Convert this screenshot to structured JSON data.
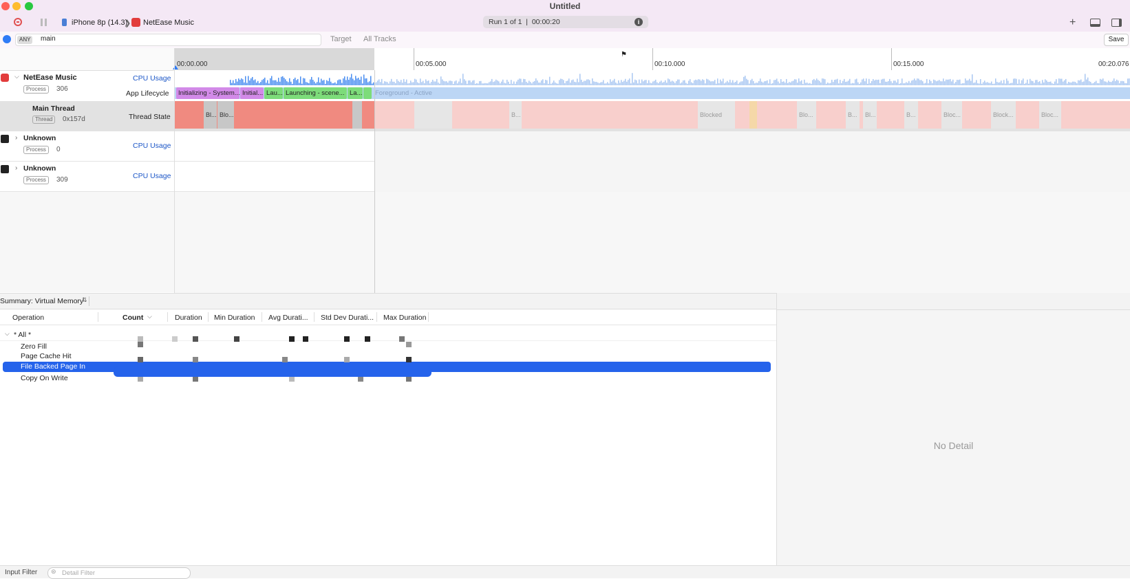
{
  "window": {
    "title": "Untitled",
    "device": "iPhone 8p (14.3)",
    "target_app": "NetEase Music",
    "run_status": "Run 1 of 1  |  00:00:20"
  },
  "filter": {
    "scope": "ANY",
    "value": "main",
    "target_label": "Target",
    "all_tracks_label": "All Tracks",
    "save_label": "Save"
  },
  "timeline": {
    "ticks": [
      "00:00.000",
      "00:05.000",
      "00:10.000",
      "00:15.000",
      "00:20.076"
    ]
  },
  "tracks": {
    "netease": {
      "name": "NetEase Music",
      "badge": "Process",
      "pid": "306",
      "cpu_label": "CPU Usage",
      "lifecycle_label": "App Lifecycle"
    },
    "main_thread": {
      "name": "Main Thread",
      "badge": "Thread",
      "tid": "0x157d",
      "state_label": "Thread State"
    },
    "unknown1": {
      "name": "Unknown",
      "badge": "Process",
      "pid": "0",
      "cpu_label": "CPU Usage"
    },
    "unknown2": {
      "name": "Unknown",
      "badge": "Process",
      "pid": "309",
      "cpu_label": "CPU Usage"
    }
  },
  "lifecycle_segments": [
    "Initializing - System...",
    "Initial...",
    "Lau...",
    "Launching - scene...",
    "La...",
    "Foreground - Active"
  ],
  "thread_state_labels": [
    "Bl...",
    "Blo...",
    "B...",
    "Blocked",
    "Blo...",
    "B...",
    "Bl...",
    "B...",
    "Bloc...",
    "Block...",
    "Bloc..."
  ],
  "summary": {
    "selector": "Summary: Virtual Memory",
    "columns": [
      "Operation",
      "Count",
      "Duration",
      "Min Duration",
      "Avg Durati...",
      "Std Dev Durati...",
      "Max Duration"
    ],
    "rows": [
      {
        "label": "* All *"
      },
      {
        "label": "Zero Fill"
      },
      {
        "label": "Page Cache Hit"
      },
      {
        "label": "File Backed Page In"
      },
      {
        "label": "Copy On Write"
      }
    ]
  },
  "detail": {
    "empty_label": "No Detail"
  },
  "bottom": {
    "input_filter_label": "Input Filter",
    "detail_filter_placeholder": "Detail Filter"
  },
  "colors": {
    "accent_blue": "#2563eb",
    "lifecycle_purple": "#d28ae8",
    "lifecycle_green": "#7ddc7a",
    "foreground_blue": "#bcd6f5",
    "running_red": "#f08a80"
  }
}
